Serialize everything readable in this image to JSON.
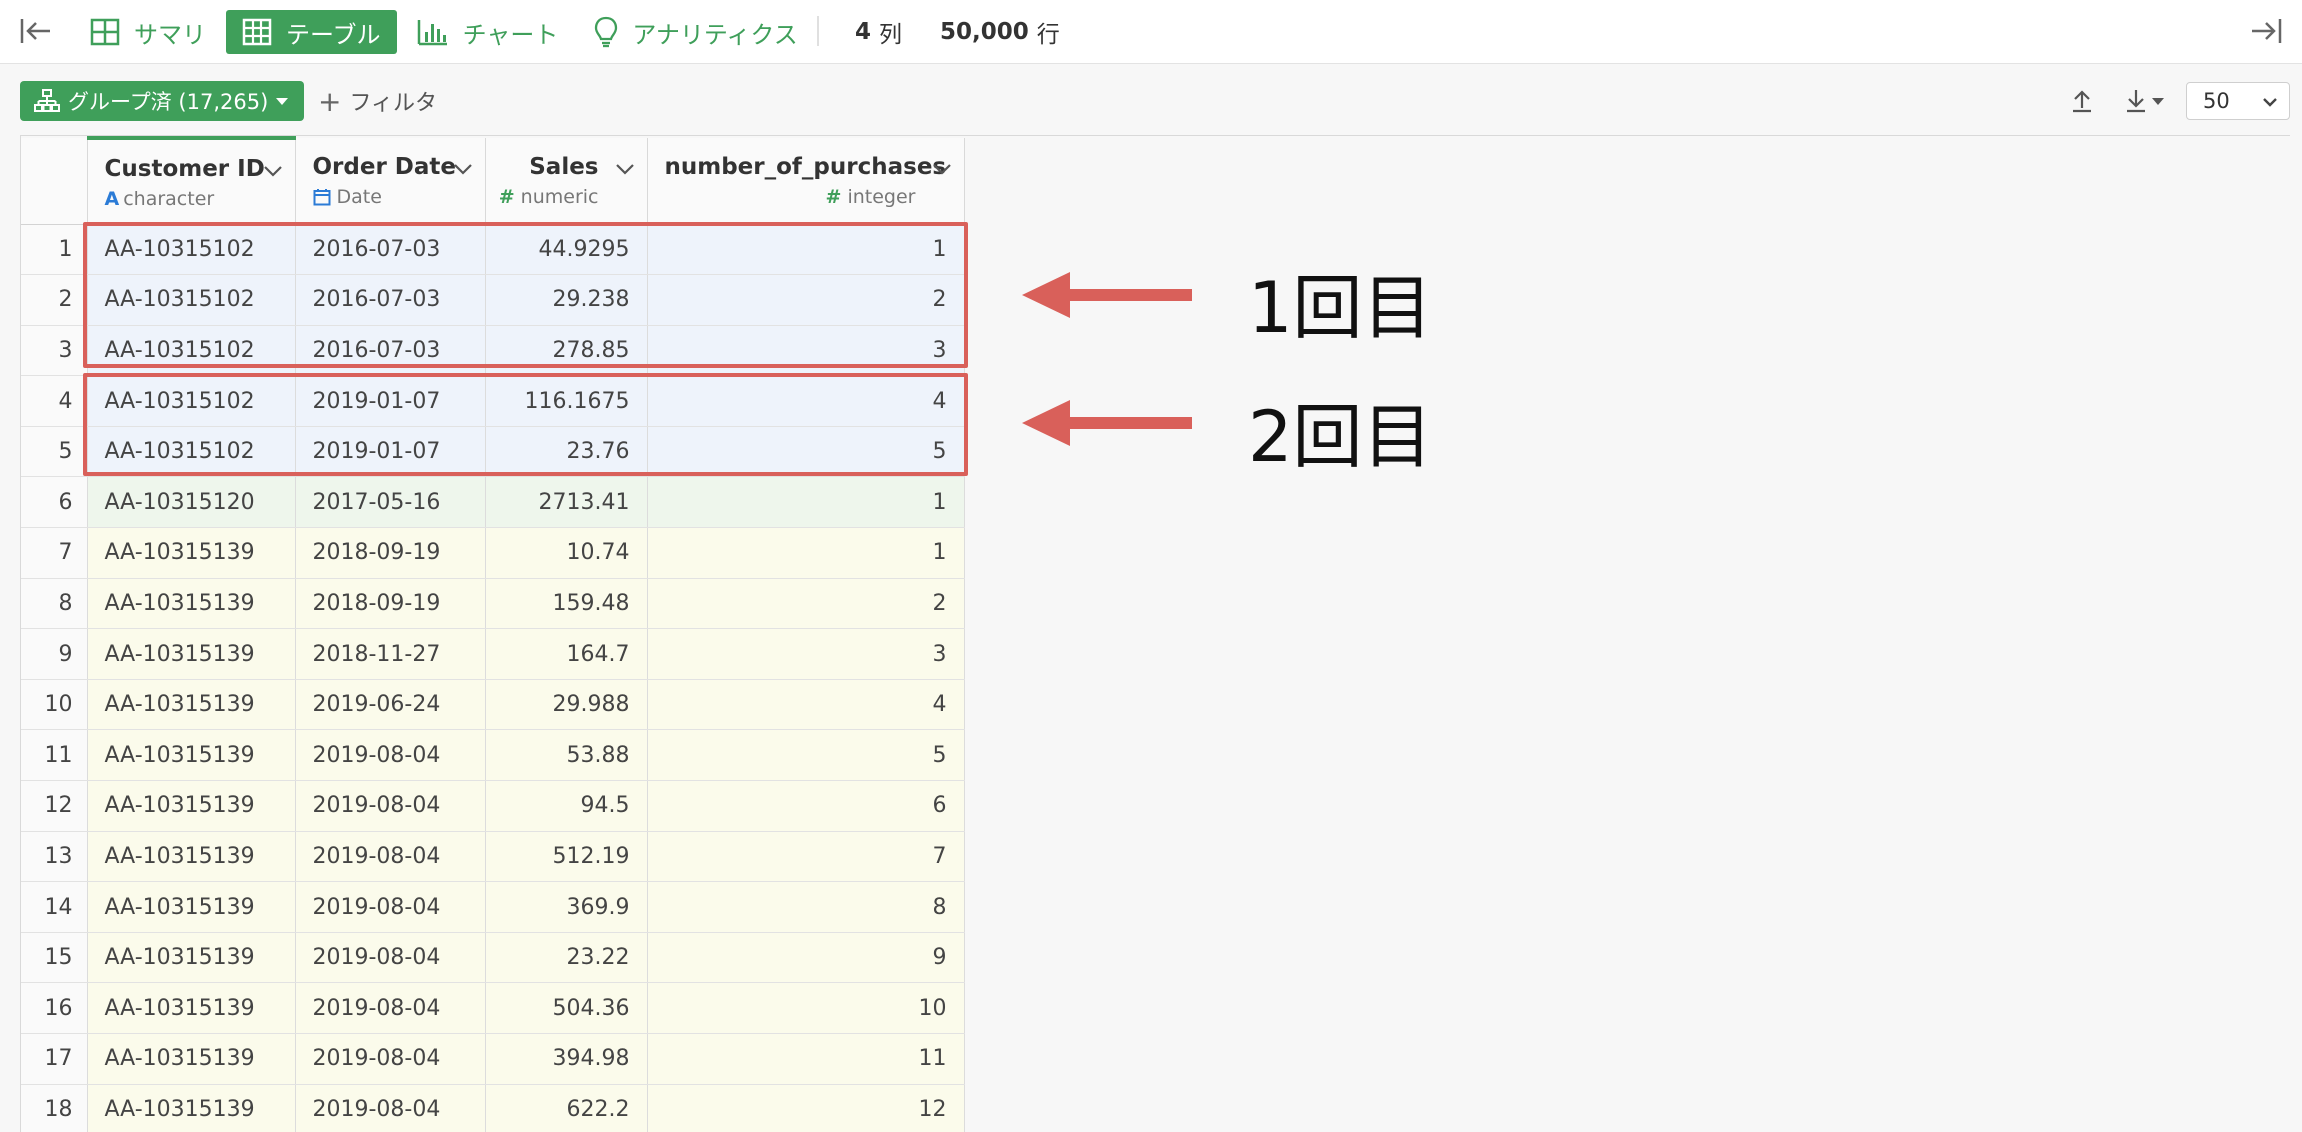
{
  "toolbar": {
    "tabs": [
      {
        "label": "サマリ",
        "icon": "grid-icon",
        "active": false
      },
      {
        "label": "テーブル",
        "icon": "table-icon",
        "active": true
      },
      {
        "label": "チャート",
        "icon": "bar-chart-icon",
        "active": false
      },
      {
        "label": "アナリティクス",
        "icon": "lightbulb-icon",
        "active": false
      }
    ],
    "columns_count": "4",
    "columns_unit": "列",
    "rows_count": "50,000",
    "rows_unit": "行"
  },
  "subtoolbar": {
    "group_label": "グループ済 (17,265)",
    "filter_label": "フィルタ",
    "page_size": "50"
  },
  "table": {
    "columns": [
      {
        "name": "Customer ID",
        "type": "character"
      },
      {
        "name": "Order Date",
        "type": "Date"
      },
      {
        "name": "Sales",
        "type": "numeric"
      },
      {
        "name": "number_of_purchases",
        "type": "integer"
      }
    ],
    "rows": [
      {
        "n": "1",
        "id": "AA-10315102",
        "date": "2016-07-03",
        "sales": "44.9295",
        "np": "1",
        "group": "g1"
      },
      {
        "n": "2",
        "id": "AA-10315102",
        "date": "2016-07-03",
        "sales": "29.238",
        "np": "2",
        "group": "g1"
      },
      {
        "n": "3",
        "id": "AA-10315102",
        "date": "2016-07-03",
        "sales": "278.85",
        "np": "3",
        "group": "g1"
      },
      {
        "n": "4",
        "id": "AA-10315102",
        "date": "2019-01-07",
        "sales": "116.1675",
        "np": "4",
        "group": "g1"
      },
      {
        "n": "5",
        "id": "AA-10315102",
        "date": "2019-01-07",
        "sales": "23.76",
        "np": "5",
        "group": "g1"
      },
      {
        "n": "6",
        "id": "AA-10315120",
        "date": "2017-05-16",
        "sales": "2713.41",
        "np": "1",
        "group": "g2"
      },
      {
        "n": "7",
        "id": "AA-10315139",
        "date": "2018-09-19",
        "sales": "10.74",
        "np": "1",
        "group": "g3"
      },
      {
        "n": "8",
        "id": "AA-10315139",
        "date": "2018-09-19",
        "sales": "159.48",
        "np": "2",
        "group": "g3"
      },
      {
        "n": "9",
        "id": "AA-10315139",
        "date": "2018-11-27",
        "sales": "164.7",
        "np": "3",
        "group": "g3"
      },
      {
        "n": "10",
        "id": "AA-10315139",
        "date": "2019-06-24",
        "sales": "29.988",
        "np": "4",
        "group": "g3"
      },
      {
        "n": "11",
        "id": "AA-10315139",
        "date": "2019-08-04",
        "sales": "53.88",
        "np": "5",
        "group": "g3"
      },
      {
        "n": "12",
        "id": "AA-10315139",
        "date": "2019-08-04",
        "sales": "94.5",
        "np": "6",
        "group": "g3"
      },
      {
        "n": "13",
        "id": "AA-10315139",
        "date": "2019-08-04",
        "sales": "512.19",
        "np": "7",
        "group": "g3"
      },
      {
        "n": "14",
        "id": "AA-10315139",
        "date": "2019-08-04",
        "sales": "369.9",
        "np": "8",
        "group": "g3"
      },
      {
        "n": "15",
        "id": "AA-10315139",
        "date": "2019-08-04",
        "sales": "23.22",
        "np": "9",
        "group": "g3"
      },
      {
        "n": "16",
        "id": "AA-10315139",
        "date": "2019-08-04",
        "sales": "504.36",
        "np": "10",
        "group": "g3"
      },
      {
        "n": "17",
        "id": "AA-10315139",
        "date": "2019-08-04",
        "sales": "394.98",
        "np": "11",
        "group": "g3"
      },
      {
        "n": "18",
        "id": "AA-10315139",
        "date": "2019-08-04",
        "sales": "622.2",
        "np": "12",
        "group": "g3"
      }
    ]
  },
  "annotations": [
    {
      "label": "1回目"
    },
    {
      "label": "2回目"
    }
  ],
  "colors": {
    "accent": "#3f9f5a",
    "highlight": "#d9605a"
  }
}
